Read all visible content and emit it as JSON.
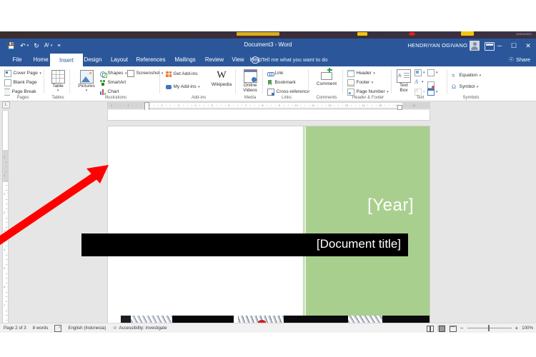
{
  "window": {
    "title": "Document3  -  Word",
    "account": "HENDRIYAN OGIVANO",
    "minimize": "─",
    "maximize": "☐",
    "close": "✕",
    "qat": [
      {
        "name": "save-icon",
        "glyph": "💾"
      },
      {
        "name": "undo-icon",
        "glyph": "↶"
      },
      {
        "name": "redo-icon",
        "glyph": "↻"
      },
      {
        "name": "autosave-icon",
        "glyph": "Aᵧ"
      },
      {
        "name": "customize-qat-icon",
        "glyph": "≡"
      }
    ]
  },
  "tabs": [
    {
      "label": "File",
      "active": false
    },
    {
      "label": "Home",
      "active": false
    },
    {
      "label": "Insert",
      "active": true
    },
    {
      "label": "Design",
      "active": false
    },
    {
      "label": "Layout",
      "active": false
    },
    {
      "label": "References",
      "active": false
    },
    {
      "label": "Mailings",
      "active": false
    },
    {
      "label": "Review",
      "active": false
    },
    {
      "label": "View",
      "active": false
    },
    {
      "label": "Help",
      "active": false
    }
  ],
  "tell_me": "Tell me what you want to do",
  "share": "Share",
  "ribbon": {
    "groups": [
      {
        "name": "Pages",
        "items": [
          "Cover Page",
          "Blank Page",
          "Page Break"
        ]
      },
      {
        "name": "Tables",
        "items": [
          "Table"
        ]
      },
      {
        "name": "Illustrations",
        "items": [
          "Pictures",
          "Shapes",
          "SmartArt",
          "Chart",
          "Screenshot"
        ]
      },
      {
        "name": "Add-ins",
        "items": [
          "Get Add-ins",
          "My Add-ins",
          "Wikipedia"
        ]
      },
      {
        "name": "Media",
        "items": [
          "Online Videos"
        ]
      },
      {
        "name": "Links",
        "items": [
          "Link",
          "Bookmark",
          "Cross-reference"
        ]
      },
      {
        "name": "Comments",
        "items": [
          "Comment"
        ]
      },
      {
        "name": "Header & Footer",
        "items": [
          "Header",
          "Footer",
          "Page Number"
        ]
      },
      {
        "name": "Text",
        "items": [
          "Text Box"
        ]
      },
      {
        "name": "Symbols",
        "items": [
          "Equation",
          "Symbol"
        ]
      }
    ],
    "labels": {
      "cover_page": "Cover Page",
      "blank_page": "Blank Page",
      "page_break": "Page Break",
      "pages_group": "Pages",
      "table": "Table",
      "tables_group": "Tables",
      "pictures": "Pictures",
      "shapes": "Shapes",
      "smartart": "SmartArt",
      "chart": "Chart",
      "screenshot": "Screenshot",
      "illustrations_group": "Illustrations",
      "get_addins": "Get Add-ins",
      "my_addins": "My Add-ins",
      "wikipedia": "Wikipedia",
      "wikipedia_glyph": "W",
      "addins_group": "Add-ins",
      "online_videos": "Online\nVideos",
      "online_videos_l1": "Online",
      "online_videos_l2": "Videos",
      "media_group": "Media",
      "link": "Link",
      "bookmark": "Bookmark",
      "cross_reference": "Cross-reference",
      "links_group": "Links",
      "comment": "Comment",
      "comments_group": "Comments",
      "header": "Header",
      "footer": "Footer",
      "page_number": "Page Number",
      "headerfooter_group": "Header & Footer",
      "text_box_l1": "Text",
      "text_box_l2": "Box",
      "text_group": "Text",
      "equation": "Equation",
      "equation_glyph": "π",
      "symbol": "Symbol",
      "symbol_glyph": "Ω",
      "symbols_group": "Symbols"
    }
  },
  "ruler": {
    "h_numbers": [
      "2",
      "1",
      "1",
      "2",
      "3",
      "4",
      "5",
      "6",
      "7",
      "8",
      "9",
      "10",
      "11",
      "12",
      "13",
      "14",
      "15",
      "17",
      "18"
    ],
    "v_numbers": [
      "2",
      "1",
      "1",
      "2",
      "3",
      "4",
      "5",
      "6",
      "7"
    ],
    "corner_glyph": "L"
  },
  "document": {
    "year": "[Year]",
    "title": "[Document title]",
    "accent_green": "#a9cf8e",
    "title_band_color": "#000000"
  },
  "status": {
    "page": "Page 2 of 3",
    "words": "8 words",
    "proofing_icon": "proofing-icon",
    "language": "English (Indonesia)",
    "accessibility": "Accessibility: Investigate",
    "zoom": "100%",
    "views": [
      "Read Mode",
      "Print Layout",
      "Web Layout"
    ],
    "zoom_out": "−",
    "zoom_in": "+"
  },
  "annotation": {
    "arrow_color": "#ff0000",
    "name": "red-arrow-pointer"
  }
}
